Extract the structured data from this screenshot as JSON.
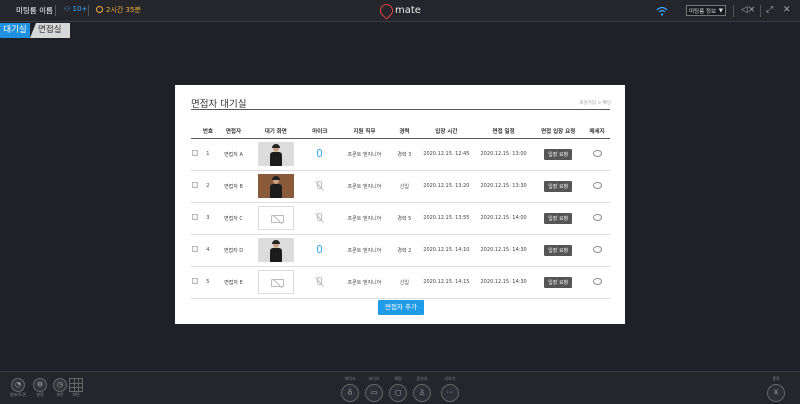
{
  "topbar": {
    "meeting_name": "미팅룸 이름",
    "participants": "10+",
    "elapsed": "2시간 35분",
    "info_select": "미팅룸 정보",
    "info_arrow": "▼"
  },
  "logo": {
    "text": "mate"
  },
  "tabs": {
    "waiting": "대기실",
    "interview": "면접실"
  },
  "panel": {
    "title": "면접자 대기실",
    "breadcrumb": "회원가입 > 확인",
    "add_button": "면접자 추가"
  },
  "table": {
    "columns": [
      "번호",
      "면접자",
      "대기 화면",
      "마이크",
      "지원 직무",
      "경력",
      "입장 시간",
      "면접 일정",
      "면접 입장 요청",
      "메세지"
    ],
    "rows": [
      {
        "no": "1",
        "name": "면접자 A",
        "video": "photo-light",
        "mic": "on",
        "job": "프론트 엔지니어",
        "career": "경력 3",
        "entry": "2020.12.15. 12:45",
        "schedule": "2020.12.15. 13:00",
        "request": "입장 요청"
      },
      {
        "no": "2",
        "name": "면접자 B",
        "video": "photo-warm",
        "mic": "off",
        "job": "프론트 엔지니어",
        "career": "신입",
        "entry": "2020.12.15. 13:20",
        "schedule": "2020.12.15. 13:30",
        "request": "입장 요청"
      },
      {
        "no": "3",
        "name": "면접자 C",
        "video": "none",
        "mic": "off",
        "job": "프론트 엔지니어",
        "career": "경력 5",
        "entry": "2020.12.15. 13:55",
        "schedule": "2020.12.15. 14:00",
        "request": "입장 요청"
      },
      {
        "no": "4",
        "name": "면접자 D",
        "video": "photo-light",
        "mic": "on",
        "job": "프론트 엔지니어",
        "career": "경력 2",
        "entry": "2020.12.15. 14:10",
        "schedule": "2020.12.15. 14:30",
        "request": "입장 요청"
      },
      {
        "no": "5",
        "name": "면접자 E",
        "video": "none",
        "mic": "off",
        "job": "프론트 엔지니어",
        "career": "신입",
        "entry": "2020.12.15. 14:15",
        "schedule": "2020.12.15. 14:30",
        "request": "입장 요청"
      }
    ]
  },
  "bottombar": {
    "left": [
      "발표/토론",
      "설정",
      "보안",
      "화면"
    ],
    "center": [
      "마이크",
      "비디오",
      "채팅",
      "참가자",
      "더보기"
    ],
    "exit": "종료"
  },
  "colors": {
    "accent": "#1f9be8",
    "background": "#1f2129",
    "timer": "#f3b13c",
    "logo": "#e0463d"
  }
}
